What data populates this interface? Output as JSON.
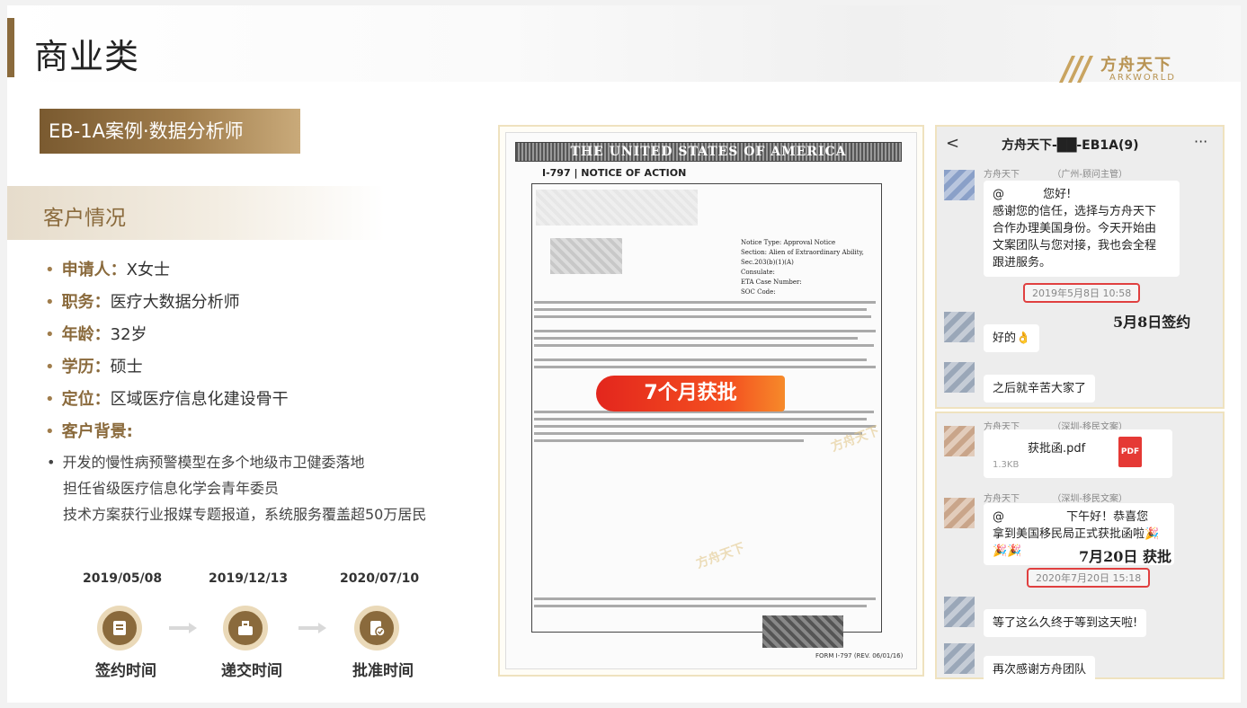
{
  "page": {
    "title": "商业类",
    "logo_cn": "方舟天下",
    "logo_en": "ARKWORLD"
  },
  "case": {
    "title": "EB-1A案例·数据分析师"
  },
  "client": {
    "section_title": "客户情况",
    "fields": [
      {
        "key": "申请人：",
        "value": "X女士"
      },
      {
        "key": "职务：",
        "value": "医疗大数据分析师"
      },
      {
        "key": "年龄：",
        "value": "32岁"
      },
      {
        "key": "学历：",
        "value": "硕士"
      },
      {
        "key": "定位：",
        "value": "区域医疗信息化建设骨干"
      },
      {
        "key": "客户背景:",
        "value": ""
      }
    ],
    "background": [
      "开发的慢性病预警模型在多个地级市卫健委落地",
      "担任省级医疗信息化学会青年委员",
      "技术方案获行业报媒专题报道，系统服务覆盖超50万居民"
    ]
  },
  "timeline": [
    {
      "date": "2019/05/08",
      "label": "签约时间",
      "icon": "sign-icon"
    },
    {
      "date": "2019/12/13",
      "label": "递交时间",
      "icon": "submit-icon"
    },
    {
      "date": "2020/07/10",
      "label": "批准时间",
      "icon": "approve-icon"
    }
  ],
  "document": {
    "banner": "THE UNITED STATES OF AMERICA",
    "subtitle": "I-797 | NOTICE OF ACTION",
    "notice_lines": [
      "Notice Type: Approval Notice",
      "Section: Alien of Extraordinary Ability,",
      "Sec.203(b)(1)(A)",
      "Consulate:",
      "ETA Case Number:",
      "SOC Code:"
    ],
    "badge": "7个月获批",
    "footer": "FORM I-797 (REV. 06/01/16)"
  },
  "chat1": {
    "back": "<",
    "title": "方舟天下-██-EB1A(9)",
    "more": "···",
    "sender": "方舟天下 　　　 （广州-顾问主管）",
    "greeting": "@　　　 您好!\n感谢您的信任，选择与方舟天下合作办理美国身份。今天开始由文案团队与您对接，我也会全程跟进服务。",
    "greeting_lines": [
      "@　　　 您好!",
      "感谢您的信任，选择与方舟天下",
      "合作办理美国身份。今天开始由",
      "文案团队与您对接，我也会全程",
      "跟进服务。"
    ],
    "timestamp": "2019年5月8日 10:58",
    "note": "5月8日签约",
    "reply1": "好的👌",
    "reply2": "之后就辛苦大家了"
  },
  "chat2": {
    "sender1": "方舟天下 　　　 （深圳-移民文案）",
    "file_name": "　　　获批函.pdf",
    "file_size": "1.3KB",
    "file_type": "PDF",
    "sender2": "方舟天下 　　　 （深圳-移民文案）",
    "congrats_lines": [
      "@　　　　　 下午好！恭喜您",
      "拿到美国移民局正式获批函啦🎉",
      "🎉🎉"
    ],
    "note": "7月20日 获批",
    "timestamp": "2020年7月20日 15:18",
    "reply1": "等了这么久终于等到这天啦!",
    "reply2": "再次感谢方舟团队"
  },
  "colors": {
    "brand_brown": "#8a6a3c",
    "brand_gold": "#b89352",
    "badge_red": "#e3261d",
    "timestamp_border": "#e04040"
  }
}
